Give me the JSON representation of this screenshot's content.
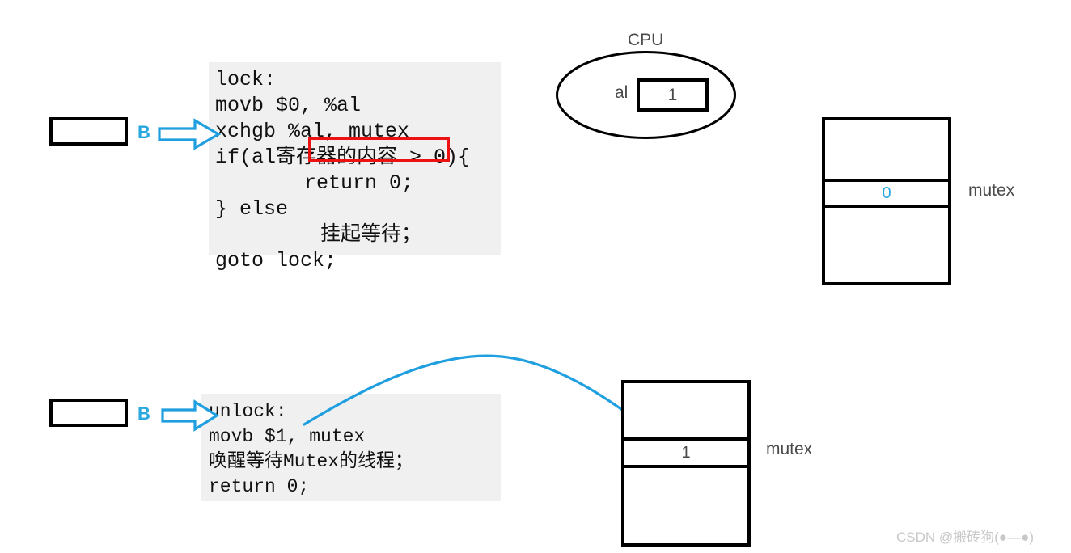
{
  "diagram": {
    "title_watermark": "CSDN @搬砖狗(●—●)",
    "accent_blue": "#29a8e0",
    "highlight_red": "#ee1111",
    "code_bg": "#f0f0f0"
  },
  "lock_code": {
    "lines": [
      "lock:",
      "movb $0, %al",
      "xchgb %al, mutex",
      "if(al寄存器的内容 > 0){",
      "return 0;",
      "} else",
      "挂起等待；",
      "goto lock;"
    ],
    "highlighted_line": "return 0;"
  },
  "unlock_code": {
    "lines": [
      "unlock:",
      "movb $1, mutex",
      "唤醒等待Mutex的线程；",
      "return 0;"
    ]
  },
  "threads": {
    "top": {
      "label": "B"
    },
    "bottom": {
      "label": "B"
    }
  },
  "cpu": {
    "label": "CPU",
    "register_name": "al",
    "register_value": "1"
  },
  "memory_top": {
    "label": "mutex",
    "value": "0",
    "cells": [
      "",
      "0",
      ""
    ]
  },
  "memory_bottom": {
    "label": "mutex",
    "value": "1",
    "cells": [
      "",
      "1",
      ""
    ]
  }
}
